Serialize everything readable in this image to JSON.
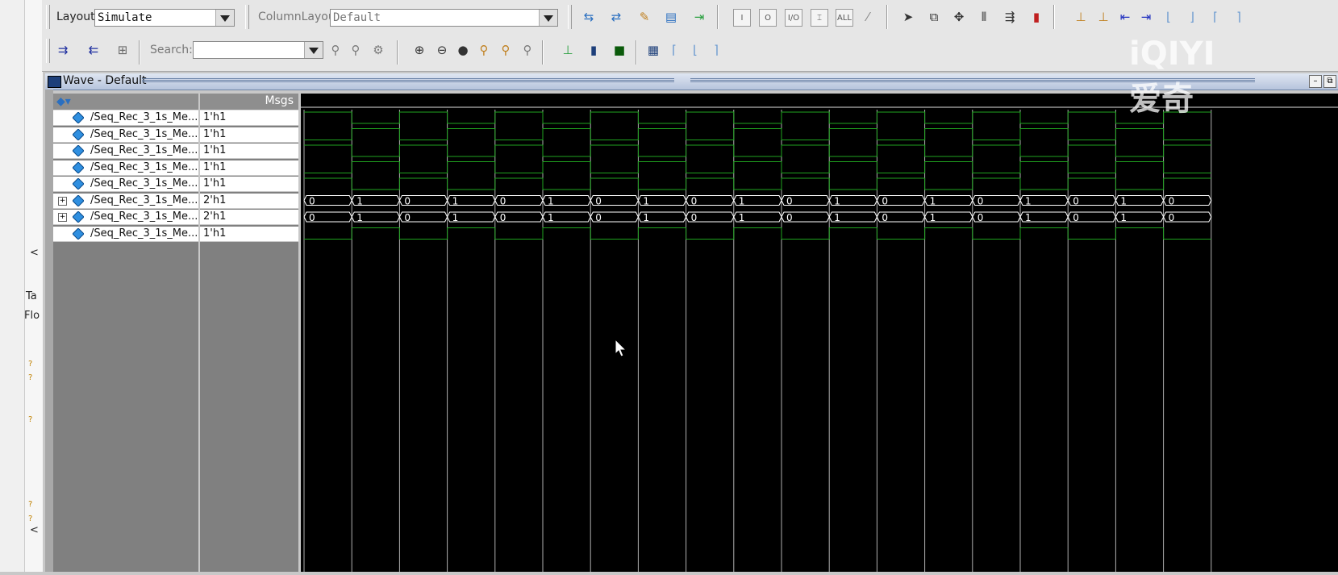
{
  "toolbar": {
    "layout_label": "Layout",
    "layout_value": "Simulate",
    "column_layout_label": "ColumnLayout",
    "column_layout_value": "Default",
    "search_label": "Search:",
    "search_value": "",
    "icon_labels": {
      "io": "I/O",
      "all": "ALL",
      "i": "I",
      "o": "O"
    }
  },
  "left_strip": {
    "tab_text": "Ta",
    "flow_text": "Flo",
    "scroll_left": "<",
    "mark": "?"
  },
  "wave_window": {
    "title": "Wave - Default",
    "msgs_header": "Msgs"
  },
  "signals": [
    {
      "name": "/Seq_Rec_3_1s_Me...",
      "value": "1'h1",
      "kind": "bit",
      "expandable": false
    },
    {
      "name": "/Seq_Rec_3_1s_Me...",
      "value": "1'h1",
      "kind": "bit",
      "expandable": false
    },
    {
      "name": "/Seq_Rec_3_1s_Me...",
      "value": "1'h1",
      "kind": "bit",
      "expandable": false
    },
    {
      "name": "/Seq_Rec_3_1s_Me...",
      "value": "1'h1",
      "kind": "bit",
      "expandable": false
    },
    {
      "name": "/Seq_Rec_3_1s_Me...",
      "value": "1'h1",
      "kind": "bit",
      "expandable": false
    },
    {
      "name": "/Seq_Rec_3_1s_Me...",
      "value": "2'h1",
      "kind": "bus",
      "expandable": true
    },
    {
      "name": "/Seq_Rec_3_1s_Me...",
      "value": "2'h1",
      "kind": "bus",
      "expandable": true
    },
    {
      "name": "/Seq_Rec_3_1s_Me...",
      "value": "1'h1",
      "kind": "bit",
      "expandable": false
    }
  ],
  "bus_values": [
    "0",
    "1",
    "0",
    "1",
    "0",
    "1",
    "0",
    "1",
    "0",
    "1",
    "0",
    "1",
    "0",
    "1",
    "0",
    "1",
    "0",
    "1",
    "0"
  ],
  "watermark": "iQIYI 爱奇",
  "colors": {
    "wave_green": "#1fa31f",
    "bus_outline": "#ffffff",
    "background": "#000000",
    "grid": "#b0b0b0"
  }
}
